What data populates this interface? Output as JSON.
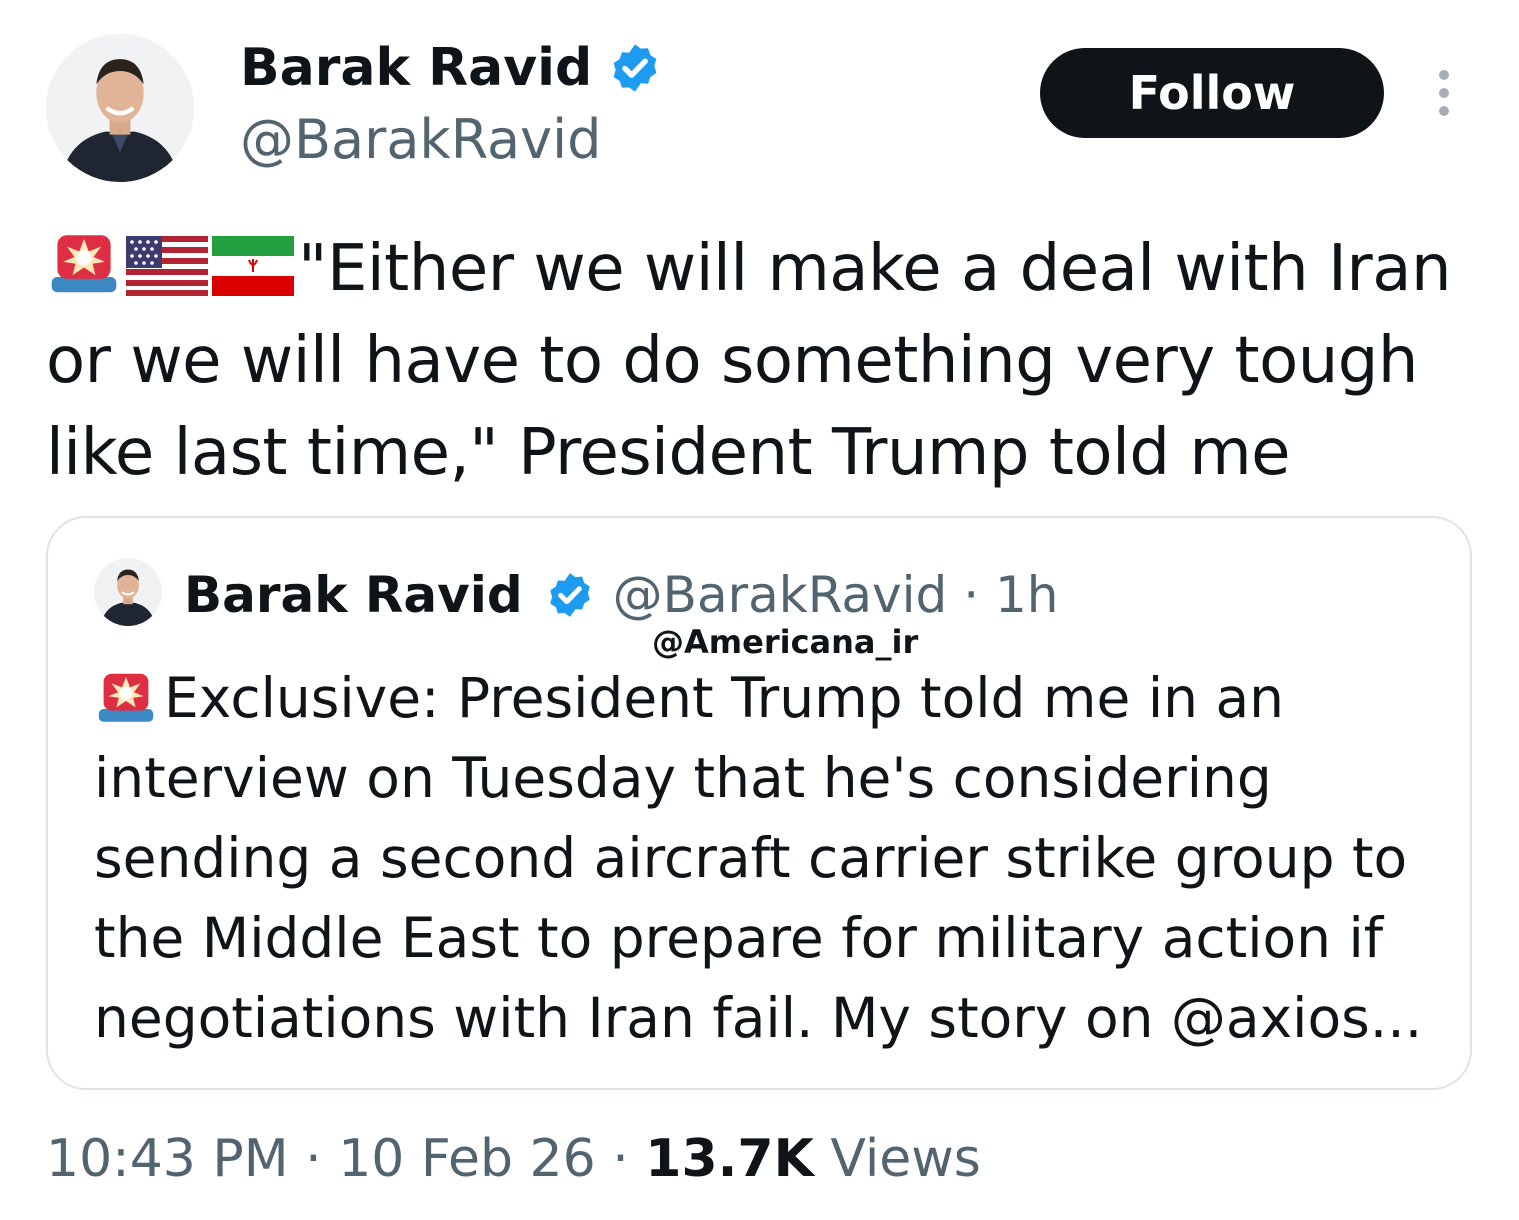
{
  "author": {
    "display_name": "Barak Ravid",
    "handle": "@BarakRavid",
    "verified": true
  },
  "follow_label": "Follow",
  "tweet": {
    "emojis": [
      "police-light-emoji",
      "us-flag-emoji",
      "iran-flag-emoji"
    ],
    "lines": [
      "\"Either we will make a deal with Iran",
      "or we will have to do something very tough",
      "like last time,\" President Trump told me"
    ]
  },
  "quoted": {
    "display_name": "Barak Ravid",
    "handle": "@BarakRavid",
    "separator": "·",
    "age": "1h",
    "watermark": "@Americana_ir",
    "emoji": "police-light-emoji",
    "lines": [
      "Exclusive: President Trump told me in an",
      "interview on Tuesday that he's considering",
      "sending a second aircraft carrier strike group to",
      "the Middle East to prepare for military action if",
      "negotiations with Iran fail. My story on @axios..."
    ]
  },
  "footer": {
    "time": "10:43 PM",
    "separator": "·",
    "date": "10 Feb 26",
    "views_count": "13.7K",
    "views_label": "Views"
  },
  "colors": {
    "text": "#0f1419",
    "secondary": "#536471",
    "verified": "#1d9bf0",
    "follow_bg": "#0f1419",
    "border": "#dfe3e6"
  }
}
